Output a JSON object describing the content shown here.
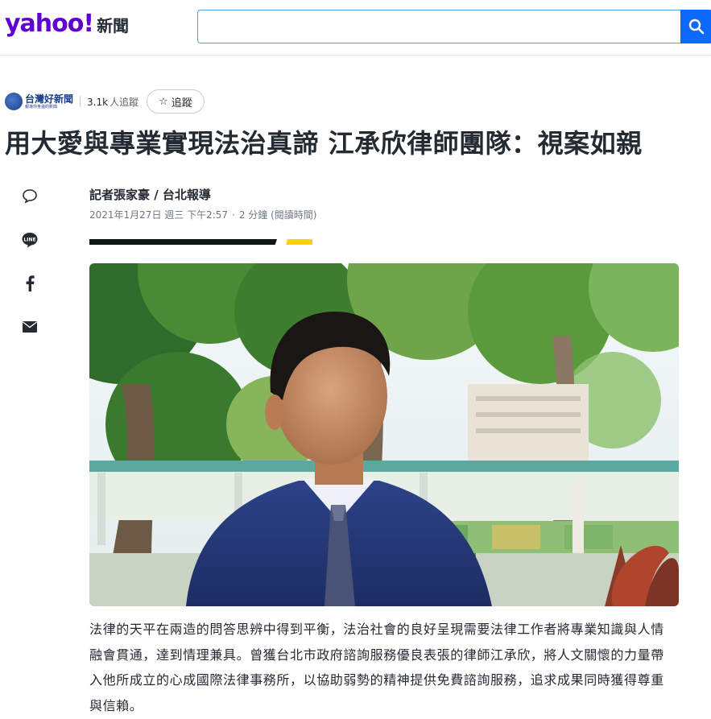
{
  "header": {
    "logo_brand": "yahoo!",
    "logo_section": "新聞",
    "search_placeholder": ""
  },
  "publisher": {
    "name": "台灣好新聞",
    "tagline": "報導你身邊的新聞",
    "followers": "3.1k",
    "followers_label": "人追蹤",
    "follow_label": "追蹤"
  },
  "article": {
    "headline": "用大愛與專業實現法治真諦 江承欣律師團隊：視案如親",
    "author": "記者張家豪 / 台北報導",
    "date": "2021年1月27日 週三 下午2:57",
    "read_time": "2 分鐘 (閱讀時間)",
    "body": "法律的天平在兩造的問答思辨中得到平衡，法治社會的良好呈現需要法律工作者將專業知識與人情融會貫通，達到情理兼具。曾獲台北市政府諮詢服務優良表張的律師江承欣，將人文關懷的力量帶入他所成立的心成國際法律事務所，以協助弱勢的精神提供免費諮詢服務，追求成果同時獲得尊重與信賴。"
  },
  "share": {
    "icons": [
      "comment-icon",
      "line-icon",
      "facebook-icon",
      "mail-icon"
    ],
    "line_text": "LINE"
  },
  "colors": {
    "brand_purple": "#6001d2",
    "search_blue": "#0f69ff",
    "accent_yellow": "#ffd200"
  }
}
